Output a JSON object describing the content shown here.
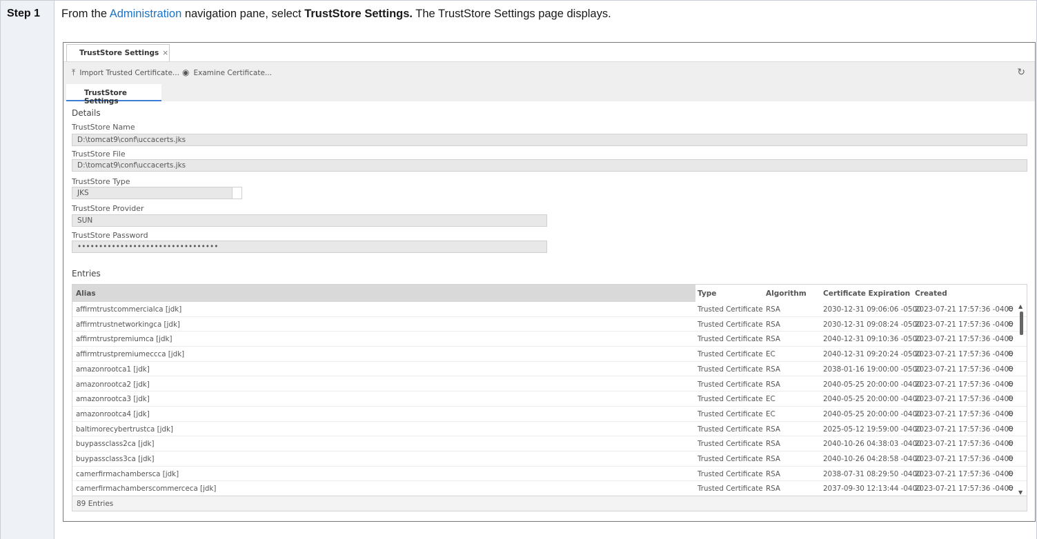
{
  "step": {
    "label": "Step 1"
  },
  "instruction": {
    "prefix": "From the ",
    "link": "Administration",
    "middle": " navigation pane, select ",
    "bold": "TrustStore Settings.",
    "suffix": " The TrustStore Settings page displays."
  },
  "window": {
    "tab_label": "TrustStore Settings",
    "tab_close": "×",
    "toolbar": {
      "import_label": "Import Trusted Certificate...",
      "examine_label": "Examine Certificate..."
    },
    "subtab_label": "TrustStore Settings"
  },
  "details": {
    "heading": "Details",
    "name_label": "TrustStore Name",
    "name_value": "D:\\tomcat9\\conf\\uccacerts.jks",
    "file_label": "TrustStore File",
    "file_value": "D:\\tomcat9\\conf\\uccacerts.jks",
    "type_label": "TrustStore Type",
    "type_value": "JKS",
    "provider_label": "TrustStore Provider",
    "provider_value": "SUN",
    "password_label": "TrustStore Password",
    "password_value": "•••••••••••••••••••••••••••••••••"
  },
  "entries": {
    "heading": "Entries",
    "columns": {
      "alias": "Alias",
      "type": "Type",
      "algorithm": "Algorithm",
      "expiration": "Certificate Expiration",
      "created": "Created"
    },
    "rows": [
      {
        "alias": "affirmtrustcommercialca [jdk]",
        "type": "Trusted Certificate",
        "algorithm": "RSA",
        "expiration": "2030-12-31 09:06:06 -0500",
        "created": "2023-07-21 17:57:36 -0400"
      },
      {
        "alias": "affirmtrustnetworkingca [jdk]",
        "type": "Trusted Certificate",
        "algorithm": "RSA",
        "expiration": "2030-12-31 09:08:24 -0500",
        "created": "2023-07-21 17:57:36 -0400"
      },
      {
        "alias": "affirmtrustpremiumca [jdk]",
        "type": "Trusted Certificate",
        "algorithm": "RSA",
        "expiration": "2040-12-31 09:10:36 -0500",
        "created": "2023-07-21 17:57:36 -0400"
      },
      {
        "alias": "affirmtrustpremiumeccca [jdk]",
        "type": "Trusted Certificate",
        "algorithm": "EC",
        "expiration": "2040-12-31 09:20:24 -0500",
        "created": "2023-07-21 17:57:36 -0400"
      },
      {
        "alias": "amazonrootca1 [jdk]",
        "type": "Trusted Certificate",
        "algorithm": "RSA",
        "expiration": "2038-01-16 19:00:00 -0500",
        "created": "2023-07-21 17:57:36 -0400"
      },
      {
        "alias": "amazonrootca2 [jdk]",
        "type": "Trusted Certificate",
        "algorithm": "RSA",
        "expiration": "2040-05-25 20:00:00 -0400",
        "created": "2023-07-21 17:57:36 -0400"
      },
      {
        "alias": "amazonrootca3 [jdk]",
        "type": "Trusted Certificate",
        "algorithm": "EC",
        "expiration": "2040-05-25 20:00:00 -0400",
        "created": "2023-07-21 17:57:36 -0400"
      },
      {
        "alias": "amazonrootca4 [jdk]",
        "type": "Trusted Certificate",
        "algorithm": "EC",
        "expiration": "2040-05-25 20:00:00 -0400",
        "created": "2023-07-21 17:57:36 -0400"
      },
      {
        "alias": "baltimorecybertrustca [jdk]",
        "type": "Trusted Certificate",
        "algorithm": "RSA",
        "expiration": "2025-05-12 19:59:00 -0400",
        "created": "2023-07-21 17:57:36 -0400"
      },
      {
        "alias": "buypassclass2ca [jdk]",
        "type": "Trusted Certificate",
        "algorithm": "RSA",
        "expiration": "2040-10-26 04:38:03 -0400",
        "created": "2023-07-21 17:57:36 -0400"
      },
      {
        "alias": "buypassclass3ca [jdk]",
        "type": "Trusted Certificate",
        "algorithm": "RSA",
        "expiration": "2040-10-26 04:28:58 -0400",
        "created": "2023-07-21 17:57:36 -0400"
      },
      {
        "alias": "camerfirmachambersca [jdk]",
        "type": "Trusted Certificate",
        "algorithm": "RSA",
        "expiration": "2038-07-31 08:29:50 -0400",
        "created": "2023-07-21 17:57:36 -0400"
      },
      {
        "alias": "camerfirmachamberscommerceca [jdk]",
        "type": "Trusted Certificate",
        "algorithm": "RSA",
        "expiration": "2037-09-30 12:13:44 -0400",
        "created": "2023-07-21 17:57:36 -0400"
      }
    ],
    "footer": "89 Entries"
  },
  "icons": {
    "import": "upload-icon",
    "examine": "eye-icon",
    "refresh": "refresh-icon",
    "remove": "remove-circle-icon"
  }
}
